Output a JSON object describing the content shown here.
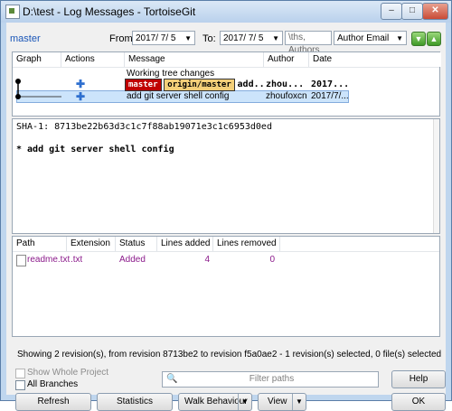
{
  "window": {
    "title": "D:\\test - Log Messages - TortoiseGit"
  },
  "filter": {
    "branch": "master",
    "from_label": "From:",
    "from_date": "2017/ 7/ 5",
    "to_label": "To:",
    "to_date": "2017/ 7/ 5",
    "search_text": "\\ths, Authors",
    "author_filter": "Author Email"
  },
  "log": {
    "columns": [
      "Graph",
      "Actions",
      "Message",
      "Author",
      "Date"
    ],
    "rows": [
      {
        "message": "Working tree changes",
        "author": "",
        "date": ""
      },
      {
        "tags": [
          "master",
          "origin/master"
        ],
        "message_suffix": "add...",
        "author": "zhou...",
        "date": "2017..."
      },
      {
        "message": "add git server shell config",
        "author": "zhoufoxcn",
        "date": "2017/7/..."
      }
    ]
  },
  "detail": {
    "sha": "SHA-1: 8713be22b63d3c1c7f88ab19071e3c1c6953d0ed",
    "message": "* add git server shell config"
  },
  "files": {
    "columns": [
      "Path",
      "Extension",
      "Status",
      "Lines added",
      "Lines removed"
    ],
    "rows": [
      {
        "path": "readme.txt",
        "ext": ".txt",
        "status": "Added",
        "added": "4",
        "removed": "0"
      }
    ]
  },
  "status_text": "Showing 2 revision(s), from revision 8713be2 to revision f5a0ae2 - 1 revision(s) selected, 0 file(s) selected",
  "options": {
    "show_whole_project": "Show Whole Project",
    "all_branches": "All Branches",
    "filter_paths_placeholder": "Filter paths"
  },
  "buttons": {
    "refresh": "Refresh",
    "statistics": "Statistics",
    "walk": "Walk Behaviour",
    "view": "View",
    "help": "Help",
    "ok": "OK"
  },
  "colors": {
    "accent": "#3f9a27",
    "tag_master": "#c00000",
    "tag_origin": "#f3cf79",
    "file_added": "#8b1a8b"
  }
}
